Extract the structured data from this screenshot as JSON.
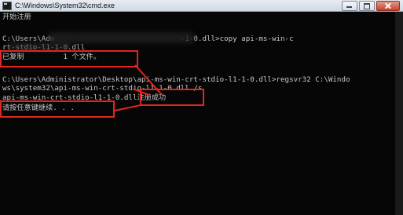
{
  "window": {
    "title": "C:\\Windows\\System32\\cmd.exe"
  },
  "console": {
    "lines": [
      "开始注册",
      "",
      "C:\\Users\\Adm                             -1-0.dll>copy api-ms-win-c",
      "rt-stdio-l1-1-0.dll",
      "已复制         1 个文件。",
      "",
      "C:\\Users\\Administrator\\Desktop\\api-ms-win-crt-stdio-l1-1-0.dll>regsvr32 C:\\Windo",
      "ws\\system32\\api-ms-win-crt-stdio-l1-1-0.dll /s",
      "api-ms-win-crt-stdio-l1-1-0.dll注册成功",
      "请按任意键继续. . ."
    ]
  },
  "annotations": {
    "copied_label": "已复制   1 个文件。",
    "success_label": "注册成功",
    "press_key_label": "请按任意键继续. . ."
  },
  "colors": {
    "annotation": "#e0261f",
    "console_text": "#c8c8c8",
    "console_bg": "#060606"
  }
}
